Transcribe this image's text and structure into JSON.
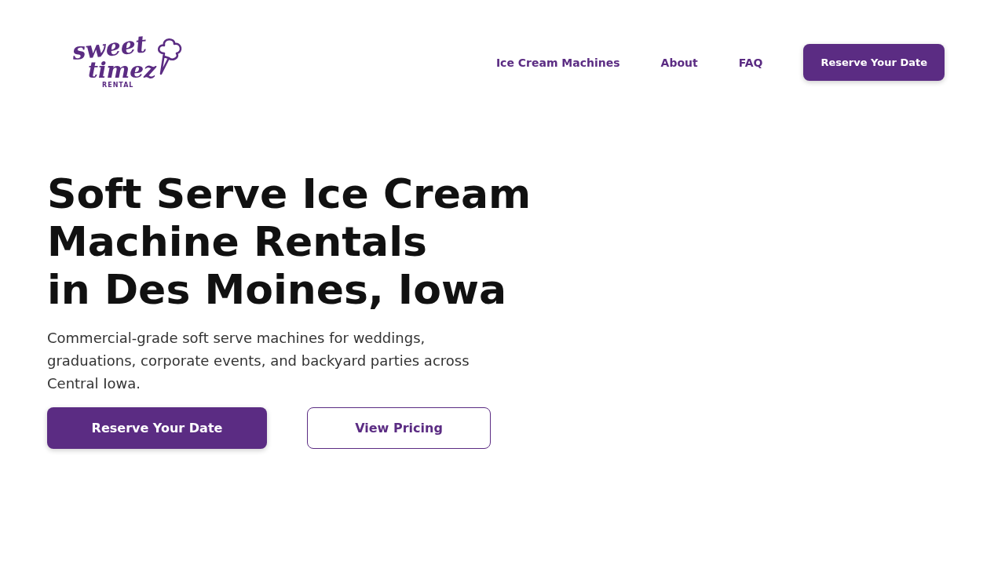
{
  "logo": {
    "line1": "sweet",
    "line2": "timez",
    "tagline": "RENTAL"
  },
  "nav": {
    "links": [
      "Ice Cream Machines",
      "About",
      "FAQ"
    ],
    "cta": "Reserve Your Date"
  },
  "hero": {
    "title_lines": [
      "Soft Serve Ice Cream",
      "Machine Rentals",
      "in Des Moines, Iowa"
    ],
    "text": "Commercial-grade soft serve machines for weddings, graduations, corporate events, and backyard parties across Central Iowa.",
    "buttons": [
      {
        "label": "Reserve Your Date",
        "kind": "primary"
      },
      {
        "label": "View Pricing",
        "kind": "outline"
      }
    ]
  }
}
